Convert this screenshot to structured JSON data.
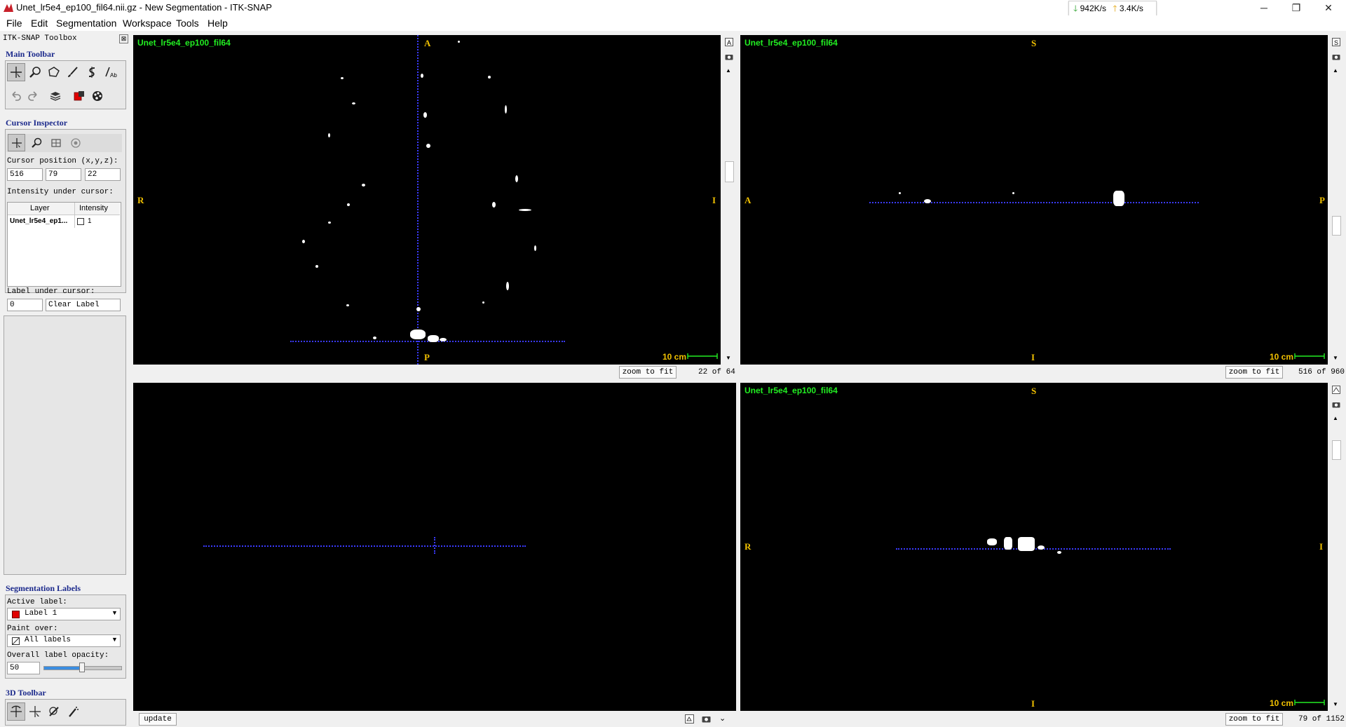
{
  "window": {
    "title": "Unet_lr5e4_ep100_fil64.nii.gz - New Segmentation - ITK-SNAP",
    "net_down": "942K/s",
    "net_up": "3.4K/s"
  },
  "menu": [
    "File",
    "Edit",
    "Segmentation",
    "Workspace",
    "Tools",
    "Help"
  ],
  "toolbox": {
    "title": "ITK-SNAP Toolbox",
    "main_toolbar_label": "Main Toolbar",
    "cursor_inspector_label": "Cursor Inspector",
    "cursor_position_label": "Cursor position (x,y,z):",
    "cursor_x": "516",
    "cursor_y": "79",
    "cursor_z": "22",
    "intensity_label": "Intensity under cursor:",
    "table_headers": [
      "Layer",
      "Intensity"
    ],
    "table_rows": [
      {
        "layer": "Unet_lr5e4_ep1...",
        "intensity": "1"
      }
    ],
    "label_under_cursor_label": "Label under cursor:",
    "label_under_cursor_value": "0",
    "label_under_cursor_name": "Clear Label",
    "seg_labels_label": "Segmentation Labels",
    "active_label_label": "Active label:",
    "active_label_value": "Label 1",
    "active_label_color": "#e00000",
    "paint_over_label": "Paint over:",
    "paint_over_value": "All labels",
    "opacity_label": "Overall label opacity:",
    "opacity_value": "50",
    "opacity_fraction": 0.5,
    "toolbar3d_label": "3D Toolbar"
  },
  "views": {
    "axial": {
      "layer": "Unet_lr5e4_ep100_fil64",
      "top": "A",
      "bottom": "P",
      "left": "R",
      "right": "I",
      "scale": "10 cm",
      "zoom": "zoom to fit",
      "slice": "22 of 64"
    },
    "sagittal": {
      "layer": "Unet_lr5e4_ep100_fil64",
      "top": "S",
      "bottom": "I",
      "left": "A",
      "right": "P",
      "scale": "10 cm",
      "zoom": "zoom to fit",
      "slice": "516 of 960"
    },
    "render3d": {
      "update": "update"
    },
    "coronal": {
      "layer": "Unet_lr5e4_ep100_fil64",
      "top": "S",
      "bottom": "I",
      "left": "R",
      "right": "I",
      "scale": "10 cm",
      "zoom": "zoom to fit",
      "slice": "79 of 1152"
    }
  },
  "colors": {
    "layer_text": "#22ee22",
    "orientation_text": "#f0c000",
    "crosshair": "#3a3aff",
    "section_header": "#1c2a8c"
  }
}
